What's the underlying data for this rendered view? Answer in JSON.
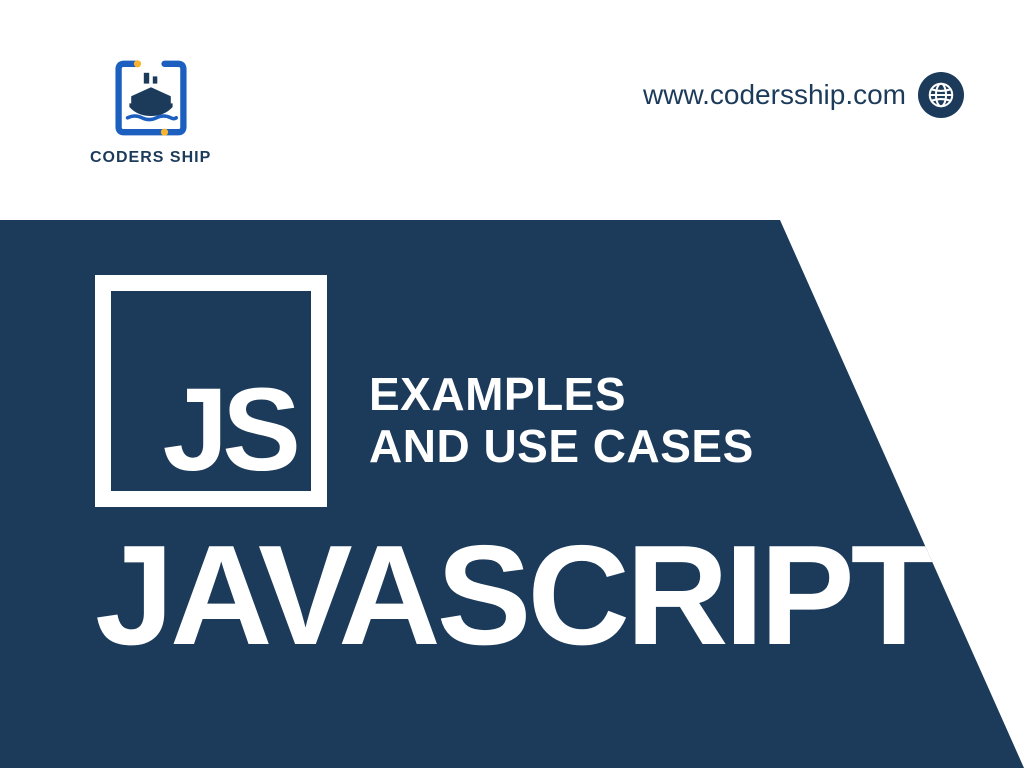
{
  "brand": {
    "name": "CODERS SHIP",
    "colors": {
      "primary": "#1c3b5a",
      "accent_yellow": "#f7b42c",
      "white": "#ffffff"
    }
  },
  "url": {
    "text": "www.codersship.com"
  },
  "hero": {
    "js_label": "JS",
    "subtitle_line1": "EXAMPLES",
    "subtitle_line2": "AND USE CASES",
    "title": "JAVASCRIPT"
  }
}
